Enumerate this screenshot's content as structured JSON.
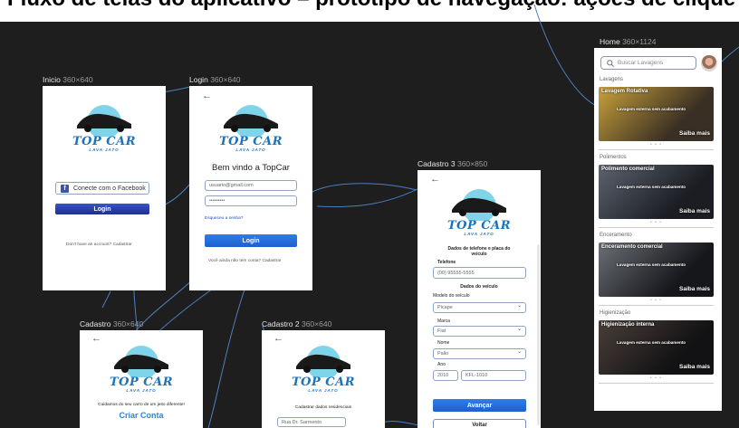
{
  "banner": {
    "text": "Fluxo de telas do aplicativo – protótipo de navegação: ações de clique e retorno"
  },
  "frames": {
    "inicio": {
      "name": "Inicio",
      "size": "360×640"
    },
    "login": {
      "name": "Login",
      "size": "360×640"
    },
    "cadastro": {
      "name": "Cadastro",
      "size": "360×640"
    },
    "cadastro2": {
      "name": "Cadastro 2",
      "size": "360×640"
    },
    "cadastro3": {
      "name": "Cadastro 3",
      "size": "360×850"
    },
    "home": {
      "name": "Home",
      "size": "360×1124"
    }
  },
  "logo": {
    "brand": "TOP CAR",
    "tagline": "LAVA JATO"
  },
  "inicio": {
    "facebook_label": "Conecte com o Facebook",
    "login_label": "Login",
    "no_account_prefix": "Don't have an account? ",
    "signup_link": "Cadastrar"
  },
  "login": {
    "back_arrow": "←",
    "welcome": "Bem vindo a TopCar",
    "email_value": "usuario@gmail.com",
    "password_value": "•••••••••",
    "forgot": "Esqueceu a senha?",
    "login_label": "Login",
    "no_account_prefix": "Você ainda não tem conta? ",
    "signup_link": "Cadastrar"
  },
  "cadastro": {
    "back_arrow": "←",
    "tagline": "Cuidamos do seu carro de um jeito diferente!",
    "create_account": "Criar Conta"
  },
  "cadastro2": {
    "back_arrow": "←",
    "heading": "Cadastrar dados residenciais",
    "street_placeholder": "Rua Dr. Sarmento"
  },
  "cadastro3": {
    "back_arrow": "←",
    "heading": "Dados de telefone e placa do veículo",
    "phone_label": "Telefone",
    "phone_value": "(00) 95555-5555",
    "vehicle_heading": "Dados do veículo",
    "model_label": "Modelo do veículo",
    "model_value": "Picape",
    "brand_label": "Marca",
    "brand_value": "Fiat",
    "name_label": "Nome",
    "name_value": "Palio",
    "year_label": "Ano",
    "year_value": "2010",
    "plate_value": "KFL-1010",
    "advance_label": "Avançar",
    "back_label": "Voltar"
  },
  "home": {
    "search_placeholder": "Buscar Lavagens",
    "sections": [
      {
        "title": "Lavagens",
        "card_title": "Lavagem Rotativa",
        "card_desc": "Lavagem externa sem acabamento",
        "more": "Saiba mais",
        "color_a": "#c9a13a",
        "color_b": "#3a2f24"
      },
      {
        "title": "Polimentos",
        "card_title": "Polimento comercial",
        "card_desc": "Lavagem externa sem acabamento",
        "more": "Saiba mais",
        "color_a": "#5d6370",
        "color_b": "#1b1d22"
      },
      {
        "title": "Enceramento",
        "card_title": "Enceramento comercial",
        "card_desc": "Lavagem externa sem acabamento",
        "more": "Saiba mais",
        "color_a": "#6c6f76",
        "color_b": "#15171b"
      },
      {
        "title": "Higienização",
        "card_title": "Higienização interna",
        "card_desc": "Lavagem externa sem acabamento",
        "more": "Saiba mais",
        "color_a": "#4a3e39",
        "color_b": "#121214"
      }
    ],
    "dots": "• • •"
  },
  "colors": {
    "primary": "#1f6fd8",
    "navy": "#1d2f8a",
    "background": "#1e1e1e",
    "flow_line": "#4d7fc0"
  }
}
